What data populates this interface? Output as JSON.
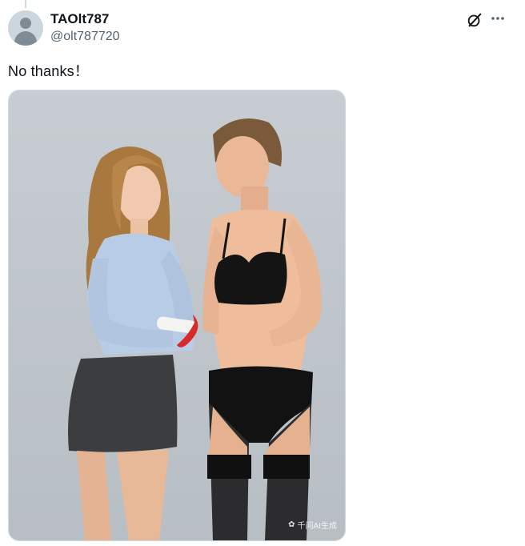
{
  "post": {
    "display_name": "TAOlt787",
    "handle": "@olt787720",
    "text": "No thanks！",
    "icons": {
      "grok": "grok-icon",
      "more": "more-icon",
      "avatar": "default-avatar-icon"
    },
    "media": {
      "watermark": "千问AI生成"
    }
  },
  "colors": {
    "text_primary": "#0f1419",
    "text_secondary": "#536471",
    "border": "#cfd9de",
    "photo_background": "#c2c8cd"
  }
}
